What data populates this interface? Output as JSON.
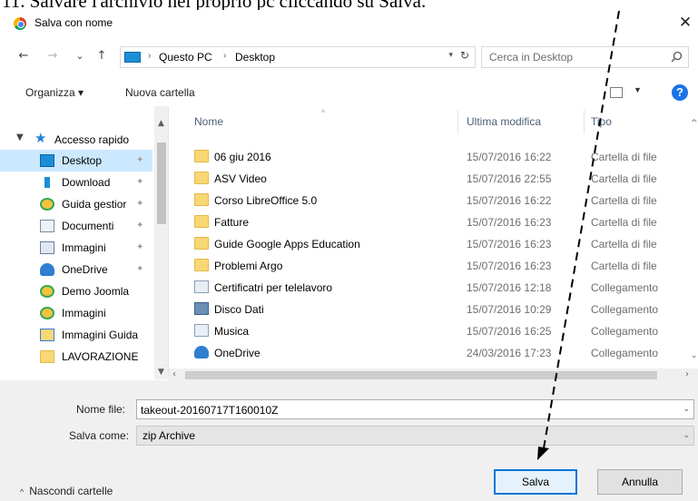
{
  "doc_heading": "11. Salvare l'archivio nel proprio pc cliccando su Salva.",
  "window": {
    "title": "Salva con nome",
    "close_glyph": "✕"
  },
  "nav": {
    "back_glyph": "←",
    "forward_glyph": "→",
    "recent_glyph": "⌄",
    "up_glyph": "↑",
    "breadcrumb": [
      "Questo PC",
      "Desktop"
    ],
    "separator_glyph": "›",
    "refresh_glyph": "↻",
    "search_placeholder": "Cerca in Desktop"
  },
  "toolbar": {
    "organize_label": "Organizza ▾",
    "new_folder_label": "Nuova cartella",
    "help_label": "?"
  },
  "sidebar": {
    "quick_access": "Accesso rapido",
    "items": [
      {
        "label": "Desktop",
        "icon": "desktop-icon",
        "pinned": true,
        "selected": true
      },
      {
        "label": "Download",
        "icon": "download-icon",
        "pinned": true
      },
      {
        "label": "Guida gestior",
        "icon": "drive-folder-icon",
        "pinned": true
      },
      {
        "label": "Documenti",
        "icon": "documents-icon",
        "pinned": true
      },
      {
        "label": "Immagini",
        "icon": "pictures-icon",
        "pinned": true
      },
      {
        "label": "OneDrive",
        "icon": "onedrive-icon",
        "pinned": true
      },
      {
        "label": "Demo Joomla",
        "icon": "drive-folder-icon"
      },
      {
        "label": "Immagini",
        "icon": "drive-folder-icon"
      },
      {
        "label": "Immagini Guida",
        "icon": "shared-folder-icon"
      },
      {
        "label": "LAVORAZIONE",
        "icon": "folder-icon"
      }
    ]
  },
  "columns": {
    "name": "Nome",
    "modified": "Ultima modifica",
    "type": "Tipo"
  },
  "files": [
    {
      "name": "06 giu 2016",
      "modified": "15/07/2016 16:22",
      "type": "Cartella di file",
      "icon": "folder-icon"
    },
    {
      "name": "ASV Video",
      "modified": "15/07/2016 22:55",
      "type": "Cartella di file",
      "icon": "folder-icon"
    },
    {
      "name": "Corso LibreOffice 5.0",
      "modified": "15/07/2016 16:22",
      "type": "Cartella di file",
      "icon": "folder-icon"
    },
    {
      "name": "Fatture",
      "modified": "15/07/2016 16:23",
      "type": "Cartella di file",
      "icon": "folder-icon"
    },
    {
      "name": "Guide Google Apps Education",
      "modified": "15/07/2016 16:23",
      "type": "Cartella di file",
      "icon": "folder-icon"
    },
    {
      "name": "Problemi Argo",
      "modified": "15/07/2016 16:23",
      "type": "Cartella di file",
      "icon": "folder-icon"
    },
    {
      "name": "Certificatri per telelavoro",
      "modified": "15/07/2016 12:18",
      "type": "Collegamento",
      "icon": "shortcut-icon"
    },
    {
      "name": "Disco Dati",
      "modified": "15/07/2016 10:29",
      "type": "Collegamento",
      "icon": "drive-shortcut-icon"
    },
    {
      "name": "Musica",
      "modified": "15/07/2016 16:25",
      "type": "Collegamento",
      "icon": "shortcut-icon"
    },
    {
      "name": "OneDrive",
      "modified": "24/03/2016 17:23",
      "type": "Collegamento",
      "icon": "onedrive-icon"
    }
  ],
  "form": {
    "filename_label": "Nome file:",
    "filename_value": "takeout-20160717T160010Z",
    "savetype_label": "Salva come:",
    "savetype_value": "zip Archive"
  },
  "footer": {
    "hide_folders": "Nascondi cartelle",
    "save_button": "Salva",
    "cancel_button": "Annulla"
  },
  "colors": {
    "accent": "#0078d7",
    "selection": "#cce8ff",
    "folder": "#f8d775",
    "column_header": "#4c607a"
  }
}
